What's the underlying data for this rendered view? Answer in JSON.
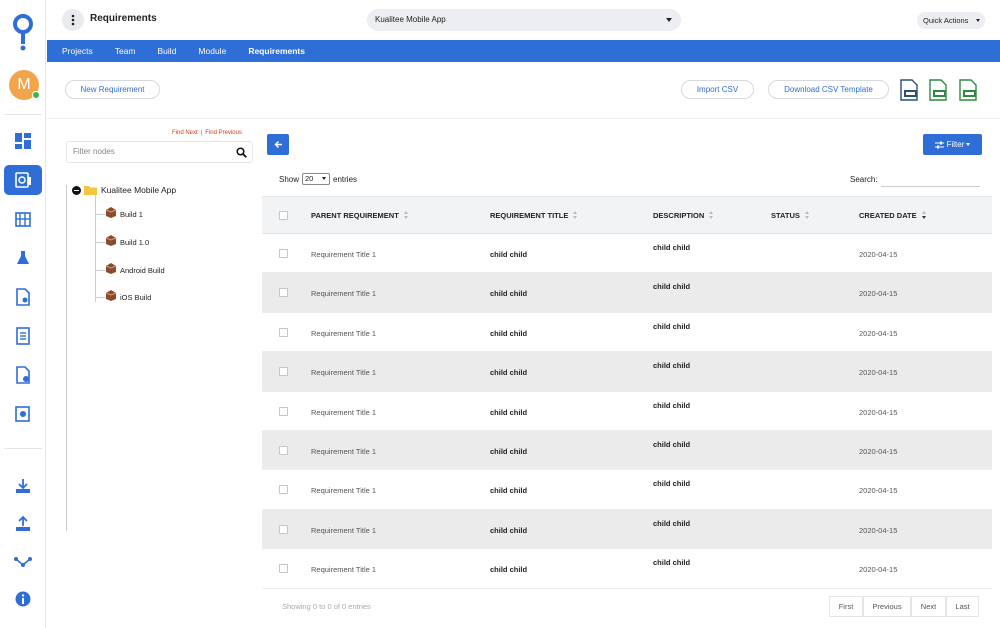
{
  "header": {
    "page_title": "Requirements",
    "project": "Kualitee Mobile App",
    "quick_actions": "Quick Actions"
  },
  "user": {
    "initial": "M"
  },
  "colors": {
    "primary": "#2f6ed6",
    "online": "#3bb54a",
    "avatar": "#f1a54a",
    "link_red": "#d9381e"
  },
  "rail": {
    "icons": [
      "dashboard-icon",
      "requirements-icon",
      "build-icon",
      "flask-icon",
      "test-doc-icon",
      "checklist-icon",
      "defect-doc-icon",
      "settings-doc-icon",
      "download-icon",
      "upload-icon",
      "integration-icon",
      "info-icon"
    ]
  },
  "tabs": [
    {
      "label": "Projects"
    },
    {
      "label": "Team"
    },
    {
      "label": "Build"
    },
    {
      "label": "Module"
    },
    {
      "label": "Requirements"
    }
  ],
  "actions": {
    "new_requirement": "New Requirement",
    "import_csv": "Import CSV",
    "download_template": "Download CSV Template",
    "file_icons": [
      "docx-export-icon",
      "xlsx-export-icon",
      "csv-export-icon"
    ]
  },
  "tree": {
    "find_next": "Find Next",
    "find_previous": "Find Previous",
    "filter_placeholder": "Filter nodes",
    "root": "Kualitee Mobile App",
    "items": [
      {
        "label": "Build 1"
      },
      {
        "label": "Build 1.0"
      },
      {
        "label": "Android Build"
      },
      {
        "label": "iOS Build"
      }
    ]
  },
  "table_controls": {
    "filter": "Filter",
    "show": "Show",
    "entries_value": "20",
    "entries": "entries",
    "search_label": "Search:"
  },
  "table": {
    "columns": [
      "PARENT REQUIREMENT",
      "REQUIREMENT TITLE",
      "DESCRIPTION",
      "STATUS",
      "CREATED DATE"
    ],
    "rows": [
      {
        "parent": "Requirement Title 1",
        "title": "child child",
        "description": "child child",
        "status": "",
        "created": "2020-04-15"
      },
      {
        "parent": "Requirement Title 1",
        "title": "child child",
        "description": "child child",
        "status": "",
        "created": "2020-04-15"
      },
      {
        "parent": "Requirement Title 1",
        "title": "child child",
        "description": "child child",
        "status": "",
        "created": "2020-04-15"
      },
      {
        "parent": "Requirement Title 1",
        "title": "child child",
        "description": "child child",
        "status": "",
        "created": "2020-04-15"
      },
      {
        "parent": "Requirement Title 1",
        "title": "child child",
        "description": "child child",
        "status": "",
        "created": "2020-04-15"
      },
      {
        "parent": "Requirement Title 1",
        "title": "child child",
        "description": "child child",
        "status": "",
        "created": "2020-04-15"
      },
      {
        "parent": "Requirement Title 1",
        "title": "child child",
        "description": "child child",
        "status": "",
        "created": "2020-04-15"
      },
      {
        "parent": "Requirement Title 1",
        "title": "child child",
        "description": "child child",
        "status": "",
        "created": "2020-04-15"
      },
      {
        "parent": "Requirement Title 1",
        "title": "child child",
        "description": "child child",
        "status": "",
        "created": "2020-04-15"
      }
    ]
  },
  "pagination": {
    "info": "Showing 0 to 0 of 0 entries",
    "first": "First",
    "previous": "Previous",
    "next": "Next",
    "last": "Last"
  }
}
